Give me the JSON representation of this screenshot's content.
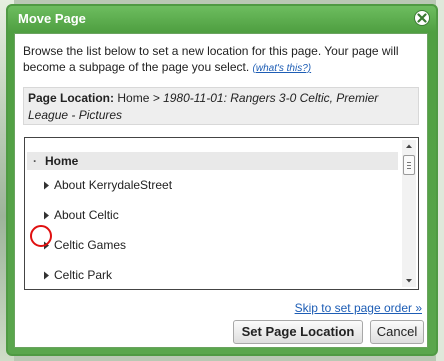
{
  "dialog": {
    "title": "Move Page"
  },
  "intro": {
    "text": "Browse the list below to set a new location for this page. Your page will become a subpage of the page you select.",
    "whats_this": "(what's this?)"
  },
  "location": {
    "label": "Page Location:",
    "parent": "Home",
    "separator": ">",
    "current": "1980-11-01: Rangers 3-0 Celtic, Premier League - Pictures"
  },
  "tree": {
    "root": "Home",
    "items": [
      "About KerrydaleStreet",
      "About Celtic",
      "Celtic Games",
      "Celtic Park"
    ]
  },
  "footer": {
    "skip_link": "Skip to set page order »",
    "set_button": "Set Page Location",
    "cancel_button": "Cancel"
  },
  "colors": {
    "titlebar": "#5aa64d",
    "link": "#1d5db5",
    "annotation": "#e01010"
  },
  "icons": {
    "close": "close-icon",
    "expander": "triangle-right-icon"
  }
}
